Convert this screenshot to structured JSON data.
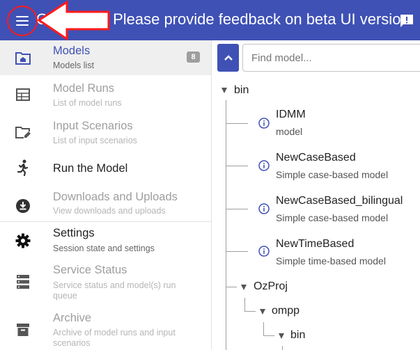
{
  "header": {
    "title": "OpenM++: Please provide feedback on beta UI version",
    "menu_icon": "menu-icon",
    "feedback_icon": "feedback-icon",
    "accent_color": "#3f51b5",
    "annotation_color": "#ff1a1a"
  },
  "nav": {
    "items": [
      {
        "title": "Models",
        "subtitle": "Models list",
        "badge": "8",
        "icon": "models-icon",
        "state": "active"
      },
      {
        "title": "Model Runs",
        "subtitle": "List of model runs",
        "icon": "table-icon",
        "state": "disabled"
      },
      {
        "title": "Input Scenarios",
        "subtitle": "List of input scenarios",
        "icon": "edit-folder-icon",
        "state": "disabled"
      },
      {
        "title": "Run the Model",
        "subtitle": "",
        "icon": "run-icon",
        "state": "enabled"
      },
      {
        "title": "Downloads and Uploads",
        "subtitle": "View downloads and uploads",
        "icon": "download-icon",
        "state": "enabled-title-gray"
      },
      {
        "title": "Settings",
        "subtitle": "Session state and settings",
        "icon": "gear-icon",
        "state": "enabled"
      },
      {
        "title": "Service Status",
        "subtitle": "Service status and model(s) run queue",
        "icon": "server-icon",
        "state": "disabled"
      },
      {
        "title": "Archive",
        "subtitle": "Archive of model runs and input scenarios",
        "icon": "archive-icon",
        "state": "disabled"
      }
    ]
  },
  "tree": {
    "search_placeholder": "Find model...",
    "root_folder": "bin",
    "models": [
      {
        "name": "IDMM",
        "description": "model"
      },
      {
        "name": "NewCaseBased",
        "description": "Simple case-based model"
      },
      {
        "name": "NewCaseBased_bilingual",
        "description": "Simple case-based model"
      },
      {
        "name": "NewTimeBased",
        "description": "Simple time-based model"
      }
    ],
    "subfolders": [
      "OzProj",
      "ompp",
      "bin"
    ]
  }
}
